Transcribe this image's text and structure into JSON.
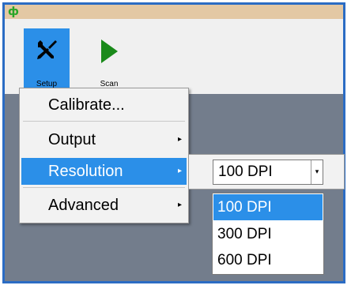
{
  "colors": {
    "accent": "#2b8fe8",
    "window_border": "#2b6cc4",
    "titlebar": "#e3c8a4",
    "workspace": "#737d8c",
    "scan_icon": "#1a8a1a"
  },
  "titlebar": {
    "app_icon": "ф"
  },
  "ribbon": {
    "setup": {
      "label": "Setup",
      "icon": "tools-icon"
    },
    "scan": {
      "label": "Scan",
      "icon": "play-icon"
    }
  },
  "menu": {
    "items": [
      {
        "label": "Calibrate...",
        "has_submenu": false,
        "active": false
      },
      {
        "label": "Output",
        "has_submenu": true,
        "active": false
      },
      {
        "label": "Resolution",
        "has_submenu": true,
        "active": true
      },
      {
        "label": "Advanced",
        "has_submenu": true,
        "active": false
      }
    ],
    "submenu_arrow": "▸"
  },
  "resolution": {
    "selected": "100 DPI",
    "drop_arrow": "▾",
    "options": [
      "100 DPI",
      "300 DPI",
      "600 DPI"
    ],
    "highlighted": "100 DPI"
  }
}
